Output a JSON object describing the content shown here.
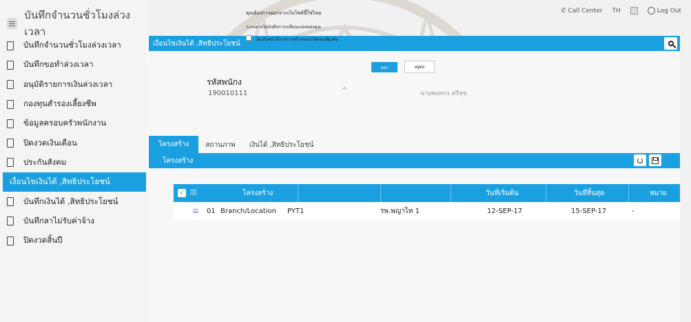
{
  "sidebar": {
    "title": "บันทึกจำนวนชั่วโมงล่วงเวลา",
    "items": [
      {
        "label": "บันทึกจำนวนชั่วโมงล่วงเวลา"
      },
      {
        "label": "บันทึกขอทำล่วงเวลา"
      },
      {
        "label": "อนุมัติรายการเงินล่วงเวลา"
      },
      {
        "label": "กองทุนสำรองเลี้ยงชีพ"
      },
      {
        "label": "ข้อมูลครอบครัวพนักงาน"
      },
      {
        "label": "ปิดงวดเงินเดือน"
      },
      {
        "label": "ประกันสังคม"
      },
      {
        "label": "เงื่อนไขเงินได้ ,สิทธิประโยชน์"
      },
      {
        "label": "บันทึกเงินได้ ,สิทธิประโยชน์"
      },
      {
        "label": "บันทึกลาไม่รับค่าจ้าง"
      },
      {
        "label": "ปิดงวดสิ้นปี"
      }
    ],
    "active_index": 7
  },
  "topbar": {
    "call_center": "Call Center",
    "language": "TH",
    "logout": "Log Out"
  },
  "dialog": {
    "message": "คุณต้องการออกจากเว็บไซต์นี้ใช่ไหม",
    "submessage": "ระบบอาจไม่บันทึกการเปลี่ยนแปลงของคุณ",
    "checkbox_label": "ป้องกันหน้านี้จากการสร้างกล่องโต้ตอบเพิ่มเติม",
    "ok_label": "ออก",
    "cancel_label": "อยู่ต่อ"
  },
  "main": {
    "title": "เงื่อนไขเงินได้ ,สิทธิประโยชน์",
    "employee_label": "รหัสพนักง",
    "employee_id": "190010111",
    "employee_name": "นายพงศกร ศรีสุข",
    "tabs": [
      "โครงสร้าง",
      "สถานภาพ",
      "เงินได้ ,สิทธิประโยชน์"
    ],
    "active_tab": 0,
    "section_title": "โครงสร้าง",
    "table": {
      "columns": [
        "โครงสร้าง",
        "",
        "",
        "วันที่เริ่มต้น",
        "วันที่สิ้นสุด",
        "หมาย"
      ],
      "rows": [
        {
          "code": "01",
          "structure": "Branch/Location",
          "value": "PYT1",
          "name": "รพ.พญาไท 1",
          "start": "12-SEP-17",
          "end": "15-SEP-17",
          "note": "-"
        }
      ]
    }
  },
  "colors": {
    "accent": "#1aa0e0",
    "sidebar_bg": "#f4f4f4",
    "page_bg": "#f1f1f1"
  }
}
